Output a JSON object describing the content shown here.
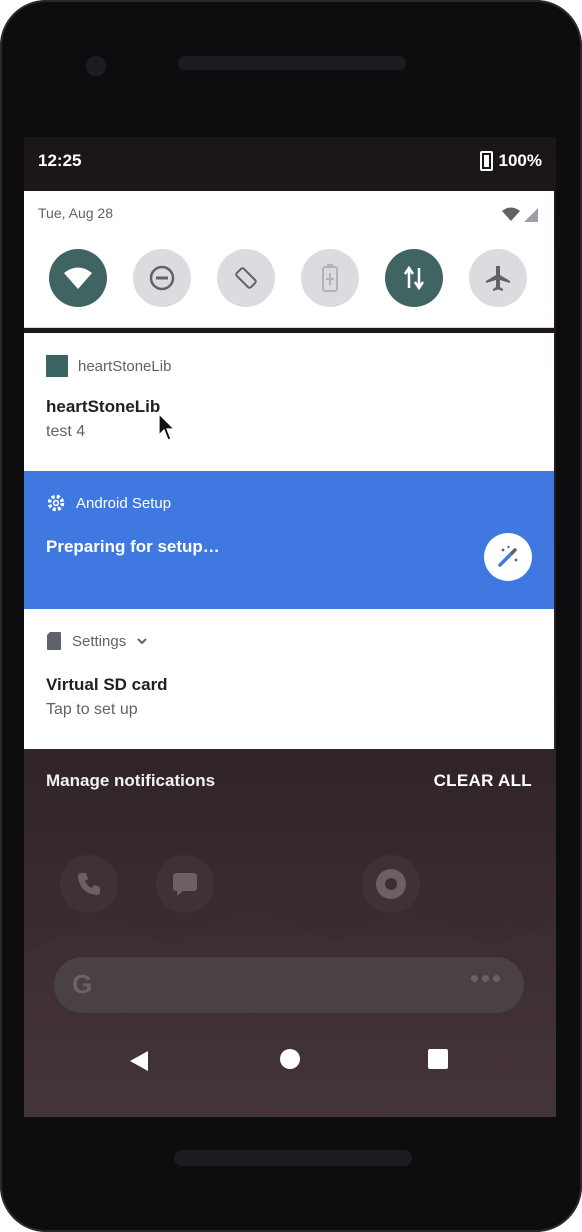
{
  "status": {
    "time": "12:25",
    "battery": "100%"
  },
  "quick_settings": {
    "date": "Tue, Aug 28",
    "tiles": [
      {
        "icon": "wifi-icon",
        "state": "on"
      },
      {
        "icon": "do-not-disturb-icon",
        "state": "off"
      },
      {
        "icon": "auto-rotate-icon",
        "state": "off"
      },
      {
        "icon": "battery-saver-icon",
        "state": "off"
      },
      {
        "icon": "mobile-data-icon",
        "state": "on"
      },
      {
        "icon": "airplane-mode-icon",
        "state": "off"
      }
    ]
  },
  "notifications": [
    {
      "app": "heartStoneLib",
      "title": "heartStoneLib",
      "text": "test 4"
    },
    {
      "app": "Android Setup",
      "title": "Preparing for setup…",
      "text": ""
    },
    {
      "app": "Settings",
      "title": "Virtual SD card",
      "text": "Tap to set up"
    }
  ],
  "footer": {
    "manage": "Manage notifications",
    "clear": "CLEAR ALL"
  },
  "colors": {
    "accent": "#3f78e0",
    "tile_on": "#3f6462",
    "tile_off": "#dadce0"
  }
}
